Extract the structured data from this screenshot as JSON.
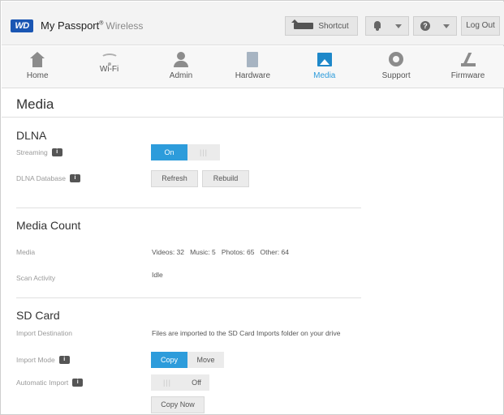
{
  "header": {
    "logo_text": "WD",
    "brand_name": "My Passport",
    "brand_reg": "®",
    "brand_suffix": "Wireless",
    "shortcut_label": "Shortcut",
    "help_glyph": "?",
    "logout_label": "Log Out"
  },
  "nav": {
    "items": [
      {
        "label": "Home",
        "icon": "home-icon"
      },
      {
        "label": "Wi-Fi",
        "icon": "wifi-icon"
      },
      {
        "label": "Admin",
        "icon": "admin-icon"
      },
      {
        "label": "Hardware",
        "icon": "hardware-icon"
      },
      {
        "label": "Media",
        "icon": "media-icon",
        "active": true
      },
      {
        "label": "Support",
        "icon": "support-icon"
      },
      {
        "label": "Firmware",
        "icon": "firmware-icon"
      }
    ]
  },
  "page": {
    "title": "Media"
  },
  "dlna": {
    "title": "DLNA",
    "streaming_label": "Streaming",
    "streaming_on": "On",
    "grip": "|||",
    "database_label": "DLNA Database",
    "refresh_label": "Refresh",
    "rebuild_label": "Rebuild"
  },
  "media_count": {
    "title": "Media Count",
    "media_label": "Media",
    "media_value": "Videos: 32   Music: 5   Photos: 65   Other: 64",
    "scan_label": "Scan Activity",
    "scan_value": "Idle"
  },
  "sd_card": {
    "title": "SD Card",
    "dest_label": "Import Destination",
    "dest_value": "Files are imported to the SD Card Imports folder on your drive",
    "mode_label": "Import Mode",
    "mode_copy": "Copy",
    "mode_move": "Move",
    "auto_label": "Automatic Import",
    "auto_grip": "|||",
    "auto_off": "Off",
    "copy_now_label": "Copy Now"
  },
  "info_glyph": "i",
  "colors": {
    "accent": "#2d9cdb",
    "logo": "#1a56b3"
  }
}
